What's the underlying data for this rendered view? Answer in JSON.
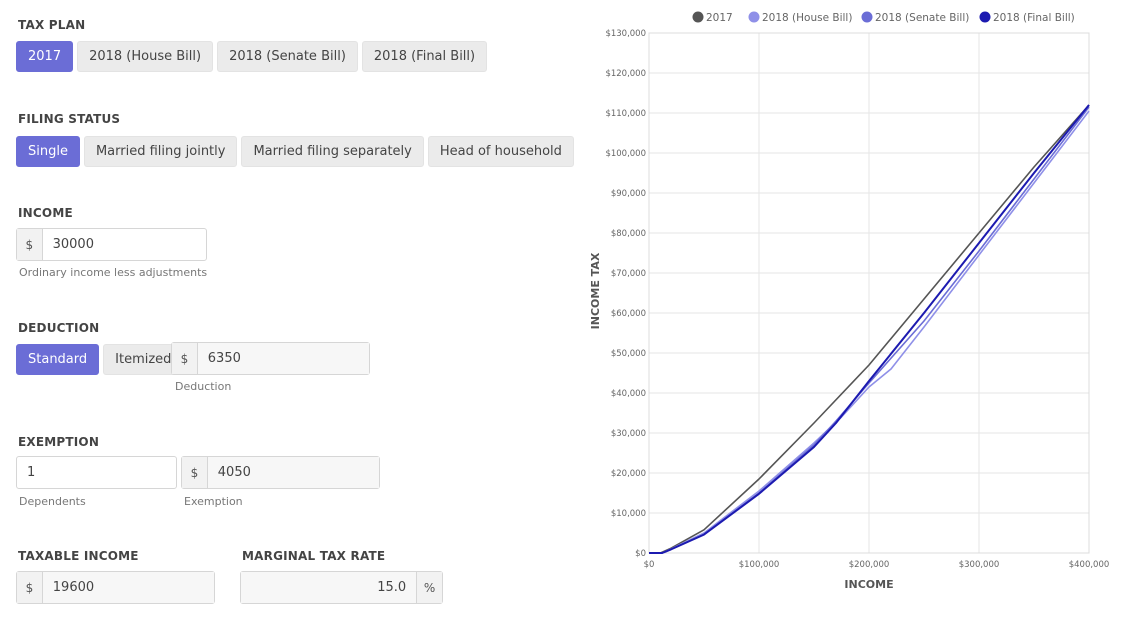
{
  "tax_plan": {
    "label": "TAX PLAN",
    "options": [
      "2017",
      "2018 (House Bill)",
      "2018 (Senate Bill)",
      "2018 (Final Bill)"
    ],
    "selected": "2017"
  },
  "filing_status": {
    "label": "FILING STATUS",
    "options": [
      "Single",
      "Married filing jointly",
      "Married filing separately",
      "Head of household"
    ],
    "selected": "Single"
  },
  "income": {
    "label": "INCOME",
    "currency": "$",
    "value": "30000",
    "help": "Ordinary income less adjustments"
  },
  "deduction": {
    "label": "DEDUCTION",
    "options": [
      "Standard",
      "Itemized"
    ],
    "selected": "Standard",
    "currency": "$",
    "value": "6350",
    "help": "Deduction"
  },
  "exemption": {
    "label": "EXEMPTION",
    "dependents": "1",
    "dependents_help": "Dependents",
    "currency": "$",
    "value": "4050",
    "help": "Exemption"
  },
  "taxable_income": {
    "label": "TAXABLE INCOME",
    "currency": "$",
    "value": "19600"
  },
  "marginal_rate": {
    "label": "MARGINAL TAX RATE",
    "value": "15.0",
    "unit": "%"
  },
  "colors": {
    "accent": "#6b6dd6",
    "grid": "#e6e6e6"
  },
  "chart_data": {
    "type": "line",
    "xlabel": "INCOME",
    "ylabel": "INCOME TAX",
    "xlim": [
      0,
      400000
    ],
    "ylim": [
      0,
      130000
    ],
    "x_ticks": [
      0,
      100000,
      200000,
      300000,
      400000
    ],
    "x_tick_labels": [
      "$0",
      "$100,000",
      "$200,000",
      "$300,000",
      "$400,000"
    ],
    "y_ticks": [
      0,
      10000,
      20000,
      30000,
      40000,
      50000,
      60000,
      70000,
      80000,
      90000,
      100000,
      110000,
      120000,
      130000
    ],
    "y_tick_labels": [
      "$0",
      "$10,000",
      "$20,000",
      "$30,000",
      "$40,000",
      "$50,000",
      "$60,000",
      "$70,000",
      "$80,000",
      "$90,000",
      "$100,000",
      "$110,000",
      "$120,000",
      "$130,000"
    ],
    "grid": true,
    "legend_position": "top",
    "series": [
      {
        "name": "2017",
        "color": "#555555",
        "x": [
          0,
          10400,
          20000,
          50000,
          100000,
          150000,
          200000,
          250000,
          300000,
          350000,
          400000
        ],
        "y": [
          0,
          0,
          1200,
          5800,
          18500,
          32500,
          47000,
          63500,
          80000,
          96500,
          112000
        ]
      },
      {
        "name": "2018 (House Bill)",
        "color": "#8f90e8",
        "x": [
          0,
          12000,
          20000,
          50000,
          100000,
          150000,
          175000,
          200000,
          220000,
          250000,
          300000,
          350000,
          400000
        ],
        "y": [
          0,
          0,
          1000,
          5000,
          15500,
          27500,
          34000,
          41500,
          46000,
          56500,
          74500,
          92500,
          110500
        ]
      },
      {
        "name": "2018 (Senate Bill)",
        "color": "#6b6dd6",
        "x": [
          0,
          12000,
          20000,
          50000,
          100000,
          150000,
          170000,
          200000,
          250000,
          300000,
          350000,
          400000
        ],
        "y": [
          0,
          0,
          900,
          4700,
          15000,
          27000,
          33000,
          42500,
          58000,
          75500,
          93500,
          111500
        ]
      },
      {
        "name": "2018 (Final Bill)",
        "color": "#1c1ab0",
        "x": [
          0,
          12000,
          20000,
          50000,
          100000,
          150000,
          170000,
          200000,
          250000,
          300000,
          350000,
          400000
        ],
        "y": [
          0,
          0,
          900,
          4600,
          14800,
          26500,
          32500,
          43000,
          60000,
          77500,
          95000,
          112000
        ]
      }
    ]
  }
}
